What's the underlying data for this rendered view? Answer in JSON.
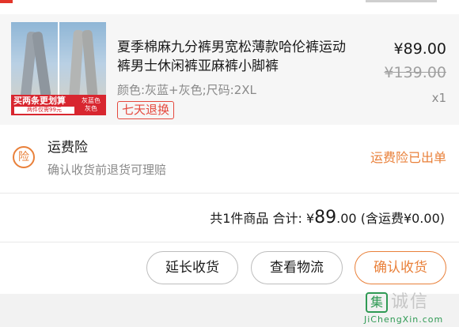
{
  "product": {
    "title": "夏季棉麻九分裤男宽松薄款哈伦裤运动裤男士休闲裤亚麻裤小脚裤",
    "variant": "颜色:灰蓝+灰色;尺码:2XL",
    "return_badge": "七天退换",
    "price": "¥89.00",
    "original_price": "¥139.00",
    "quantity": "x1",
    "promo": {
      "headline": "买两条更划算",
      "subline": "两件仅需99元",
      "color_note": "灰蓝色 灰色"
    }
  },
  "insurance": {
    "icon_char": "险",
    "title": "运费险",
    "description": "确认收货前退货可理赔",
    "status": "运费险已出单"
  },
  "summary": {
    "count_text": "共1件商品",
    "total_label": "合计:",
    "currency": "¥",
    "amount_int": "89",
    "amount_dec": ".00",
    "shipping_note": "(含运费¥0.00)"
  },
  "actions": {
    "extend": "延长收货",
    "logistics": "查看物流",
    "confirm": "确认收货"
  },
  "watermark": {
    "mark": "集",
    "text": "诚信",
    "url": "JiChengXin.com"
  },
  "colors": {
    "accent": "#e9803a",
    "badge_red": "#e5483d",
    "promo_red": "#d8262f"
  }
}
